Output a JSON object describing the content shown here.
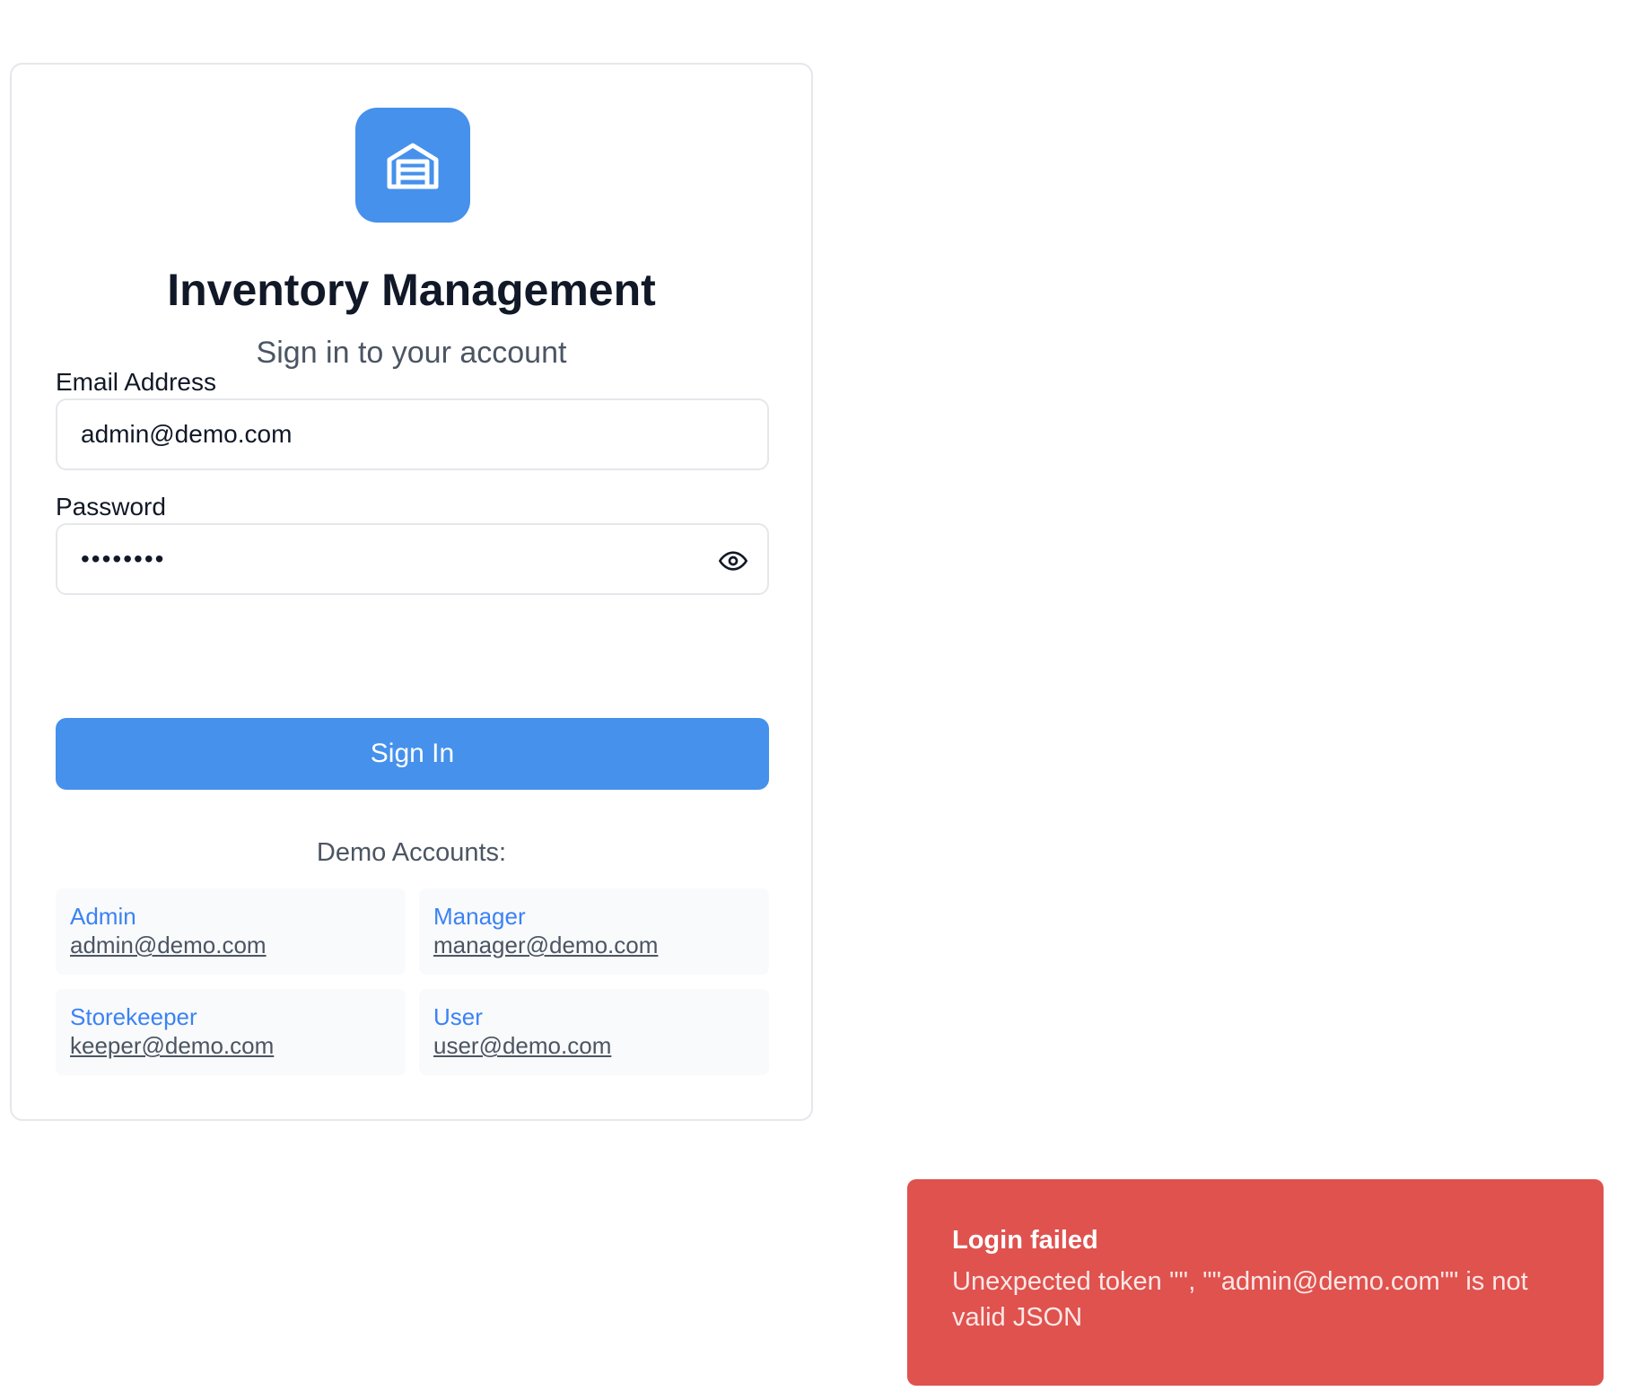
{
  "app": {
    "title": "Inventory Management",
    "subtitle": "Sign in to your account",
    "logo_icon": "warehouse-icon",
    "accent_color": "#4591ec"
  },
  "form": {
    "email_label": "Email Address",
    "email_value": "admin@demo.com",
    "password_label": "Password",
    "password_masked": "••••••••",
    "password_toggle_icon": "eye-icon",
    "submit_label": "Sign In"
  },
  "demo": {
    "heading": "Demo Accounts:",
    "accounts": [
      {
        "role": "Admin",
        "email": "admin@demo.com"
      },
      {
        "role": "Manager",
        "email": "manager@demo.com"
      },
      {
        "role": "Storekeeper",
        "email": "keeper@demo.com"
      },
      {
        "role": "User",
        "email": "user@demo.com"
      }
    ]
  },
  "toast": {
    "title": "Login failed",
    "message": "Unexpected token '\"', \"\"admin@demo.com\"\" is not valid JSON",
    "color": "#df524e"
  }
}
